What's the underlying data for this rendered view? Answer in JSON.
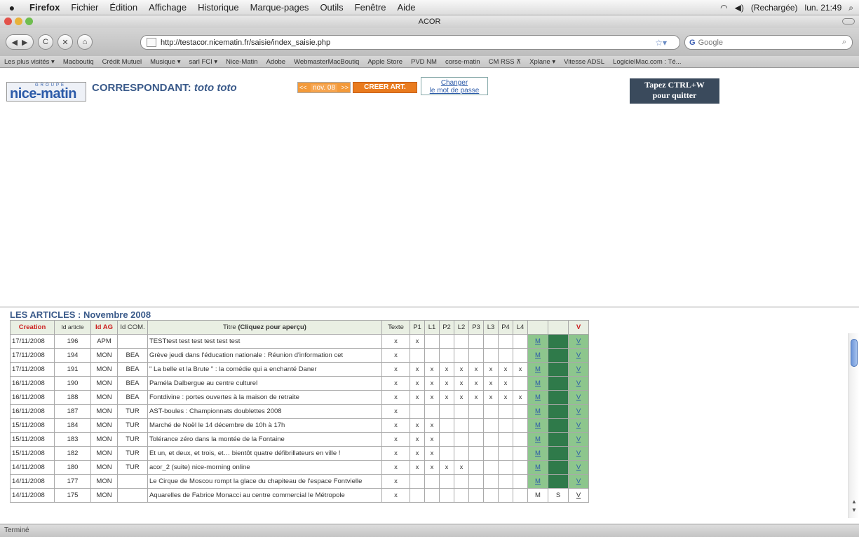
{
  "menubar": {
    "app": "Firefox",
    "menus": [
      "Fichier",
      "Édition",
      "Affichage",
      "Historique",
      "Marque-pages",
      "Outils",
      "Fenêtre",
      "Aide"
    ],
    "status_text": "(Rechargée)",
    "clock": "lun. 21:49"
  },
  "window": {
    "title": "ACOR"
  },
  "toolbar": {
    "back": "◀",
    "forward": "▶",
    "reload": "C",
    "stop": "✕",
    "home": "⌂",
    "url": "http://testacor.nicematin.fr/saisie/index_saisie.php",
    "search_placeholder": "Google",
    "search_engine": "G"
  },
  "bookmarks": [
    "Les plus visités ▾",
    "Macboutiq",
    "Crédit Mutuel",
    "Musique ▾",
    "sarl FCI ▾",
    "Nice-Matin",
    "Adobe",
    "WebmasterMacBoutiq",
    "Apple Store",
    "PVD NM",
    "corse-matin",
    "CM RSS ⊼",
    "Xplane ▾",
    "Vitesse ADSL",
    "LogicielMac.com : Té..."
  ],
  "header": {
    "logo_groupe": "GROUPE",
    "logo_text": "nice-matin",
    "correspondant_label": "CORRESPONDANT: ",
    "correspondant_name": "toto toto",
    "prev": "<<",
    "month": "nov. 08",
    "next": ">>",
    "create": "CREER ART.",
    "password_line1": "Changer",
    "password_line2": "le mot de passe",
    "quit_line1": "Tapez CTRL+W",
    "quit_line2": "pour quitter"
  },
  "articles": {
    "title": "LES ARTICLES : Novembre 2008",
    "headers": {
      "creation": "Creation",
      "id_article": "Id article",
      "id_ag": "Id AG",
      "id_com": "Id COM.",
      "titre": "Titre",
      "titre_hint": "(Cliquez pour aperçu)",
      "texte": "Texte",
      "p1": "P1",
      "l1": "L1",
      "p2": "P2",
      "l2": "L2",
      "p3": "P3",
      "l3": "L3",
      "p4": "P4",
      "l4": "L4",
      "v": "V"
    },
    "rows": [
      {
        "date": "17/11/2008",
        "id": "196",
        "ag": "APM",
        "com": "",
        "title": "TESTtest test test test test test",
        "texte": "x",
        "cols": [
          "x",
          "",
          "",
          "",
          "",
          "",
          "",
          ""
        ],
        "m": "M",
        "s": "",
        "v": "V",
        "style": "green"
      },
      {
        "date": "17/11/2008",
        "id": "194",
        "ag": "MON",
        "com": "BEA",
        "title": "Grève jeudi dans l'éducation nationale : Réunion d'information cet",
        "texte": "x",
        "cols": [
          "",
          "",
          "",
          "",
          "",
          "",
          "",
          ""
        ],
        "m": "M",
        "s": "",
        "v": "V",
        "style": "green"
      },
      {
        "date": "17/11/2008",
        "id": "191",
        "ag": "MON",
        "com": "BEA",
        "title": "\" La belle et la Brute \" : la comédie qui a enchanté Daner",
        "texte": "x",
        "cols": [
          "x",
          "x",
          "x",
          "x",
          "x",
          "x",
          "x",
          "x"
        ],
        "m": "M",
        "s": "",
        "v": "V",
        "style": "green"
      },
      {
        "date": "16/11/2008",
        "id": "190",
        "ag": "MON",
        "com": "BEA",
        "title": "Paméla Dalbergue au centre culturel",
        "texte": "x",
        "cols": [
          "x",
          "x",
          "x",
          "x",
          "x",
          "x",
          "x",
          ""
        ],
        "m": "M",
        "s": "",
        "v": "V",
        "style": "green"
      },
      {
        "date": "16/11/2008",
        "id": "188",
        "ag": "MON",
        "com": "BEA",
        "title": "Fontdivine : portes ouvertes à la maison de retraite",
        "texte": "x",
        "cols": [
          "x",
          "x",
          "x",
          "x",
          "x",
          "x",
          "x",
          "x"
        ],
        "m": "M",
        "s": "",
        "v": "V",
        "style": "green"
      },
      {
        "date": "16/11/2008",
        "id": "187",
        "ag": "MON",
        "com": "TUR",
        "title": "AST-boules : Championnats doublettes 2008",
        "texte": "x",
        "cols": [
          "",
          "",
          "",
          "",
          "",
          "",
          "",
          ""
        ],
        "m": "M",
        "s": "",
        "v": "V",
        "style": "green"
      },
      {
        "date": "15/11/2008",
        "id": "184",
        "ag": "MON",
        "com": "TUR",
        "title": "Marché de Noël le 14 décembre de 10h à 17h",
        "texte": "x",
        "cols": [
          "x",
          "x",
          "",
          "",
          "",
          "",
          "",
          ""
        ],
        "m": "M",
        "s": "",
        "v": "V",
        "style": "green"
      },
      {
        "date": "15/11/2008",
        "id": "183",
        "ag": "MON",
        "com": "TUR",
        "title": "Tolérance zéro dans la montée de la Fontaine",
        "texte": "x",
        "cols": [
          "x",
          "x",
          "",
          "",
          "",
          "",
          "",
          ""
        ],
        "m": "M",
        "s": "",
        "v": "V",
        "style": "green"
      },
      {
        "date": "15/11/2008",
        "id": "182",
        "ag": "MON",
        "com": "TUR",
        "title": "Et un, et deux, et trois, et… bientôt quatre défibrillateurs en ville !",
        "texte": "x",
        "cols": [
          "x",
          "x",
          "",
          "",
          "",
          "",
          "",
          ""
        ],
        "m": "M",
        "s": "",
        "v": "V",
        "style": "green"
      },
      {
        "date": "14/11/2008",
        "id": "180",
        "ag": "MON",
        "com": "TUR",
        "title": "acor_2 (suite) nice-morning online",
        "texte": "x",
        "cols": [
          "x",
          "x",
          "x",
          "x",
          "",
          "",
          "",
          ""
        ],
        "m": "M",
        "s": "",
        "v": "V",
        "style": "green"
      },
      {
        "date": "14/11/2008",
        "id": "177",
        "ag": "MON",
        "com": "",
        "title": "Le Cirque de Moscou rompt la glace du chapiteau de l'espace Fontvielle",
        "texte": "x",
        "cols": [
          "",
          "",
          "",
          "",
          "",
          "",
          "",
          ""
        ],
        "m": "M",
        "s": "",
        "v": "V",
        "style": "green"
      },
      {
        "date": "14/11/2008",
        "id": "175",
        "ag": "MON",
        "com": "",
        "title": "Aquarelles de Fabrice Monacci au centre commercial le Métropole",
        "texte": "x",
        "cols": [
          "",
          "",
          "",
          "",
          "",
          "",
          "",
          ""
        ],
        "m": "M",
        "s": "S",
        "v": "V",
        "style": "plain"
      }
    ]
  },
  "statusbar": {
    "text": "Terminé"
  }
}
